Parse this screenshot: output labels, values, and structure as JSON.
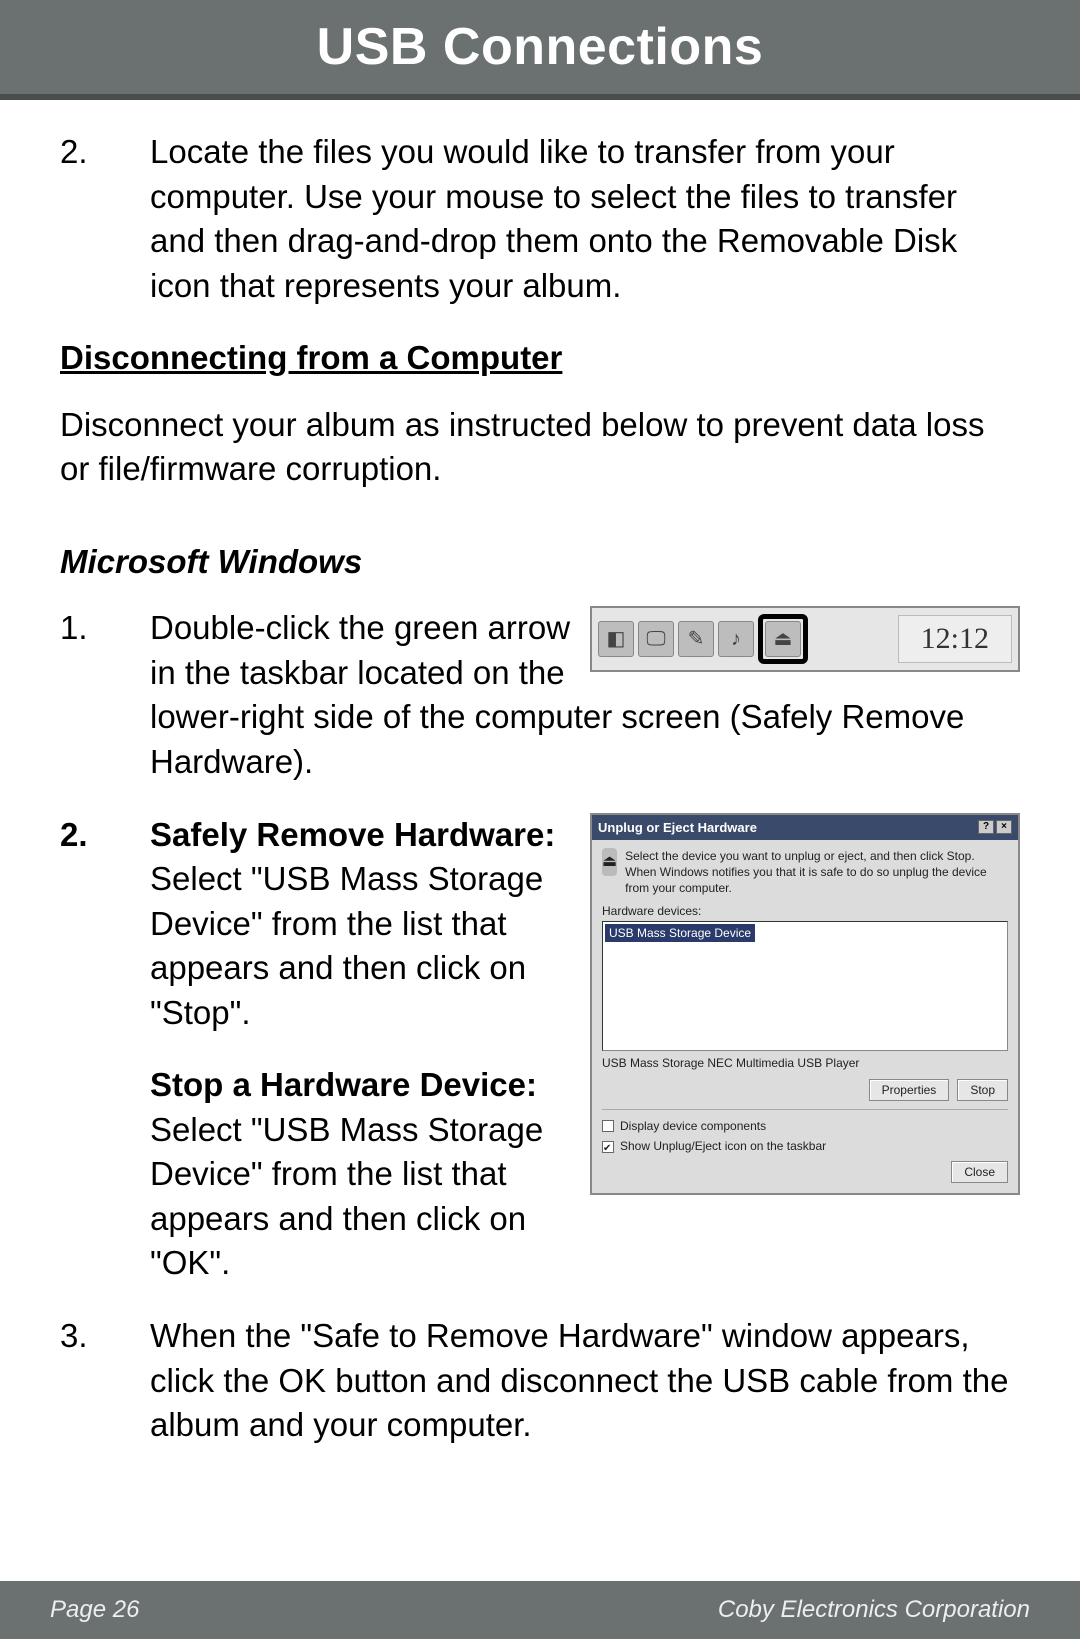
{
  "header": {
    "title": "USB Connections"
  },
  "steps_top": {
    "num2": "2.",
    "text2": "Locate the files you would like to transfer from your computer. Use your mouse to select the files to transfer and then drag-and-drop them onto the Removable Disk icon that represents your album."
  },
  "section_disconnect": {
    "heading": "Disconnecting from a Computer",
    "intro": "Disconnect your album as instructed below to prevent data loss or file/firmware corruption."
  },
  "subsection_windows": {
    "heading": "Microsoft Windows"
  },
  "win_steps": {
    "num1": "1.",
    "text1": "Double-click the green arrow in the taskbar located on the lower-right side of the computer screen (Safely Remove Hardware).",
    "num2": "2.",
    "bold2a": "Safely Remove Hardware:",
    "text2a": " Select \"USB Mass Storage Device\" from the list that appears and then click on \"Stop\".",
    "bold2b": "Stop a Hardware Device:",
    "text2b": " Select \"USB Mass Storage Device\" from the list that appears and then click on \"OK\".",
    "num3": "3.",
    "text3": "When the \"Safe to Remove Hardware\" window appears, click the OK button and disconnect the USB cable from the album and your computer."
  },
  "taskbar": {
    "clock": "12:12"
  },
  "dialog": {
    "title": "Unplug or Eject Hardware",
    "instruction": "Select the device you want to unplug or eject, and then click Stop. When Windows notifies you that it is safe to do so unplug the device from your computer.",
    "list_label": "Hardware devices:",
    "list_item": "USB Mass Storage Device",
    "below_list": "USB Mass Storage NEC Multimedia USB Player",
    "btn_properties": "Properties",
    "btn_stop": "Stop",
    "chk1": "Display device components",
    "chk2": "Show Unplug/Eject icon on the taskbar",
    "btn_close": "Close"
  },
  "footer": {
    "page": "Page 26",
    "company": "Coby Electronics Corporation"
  }
}
